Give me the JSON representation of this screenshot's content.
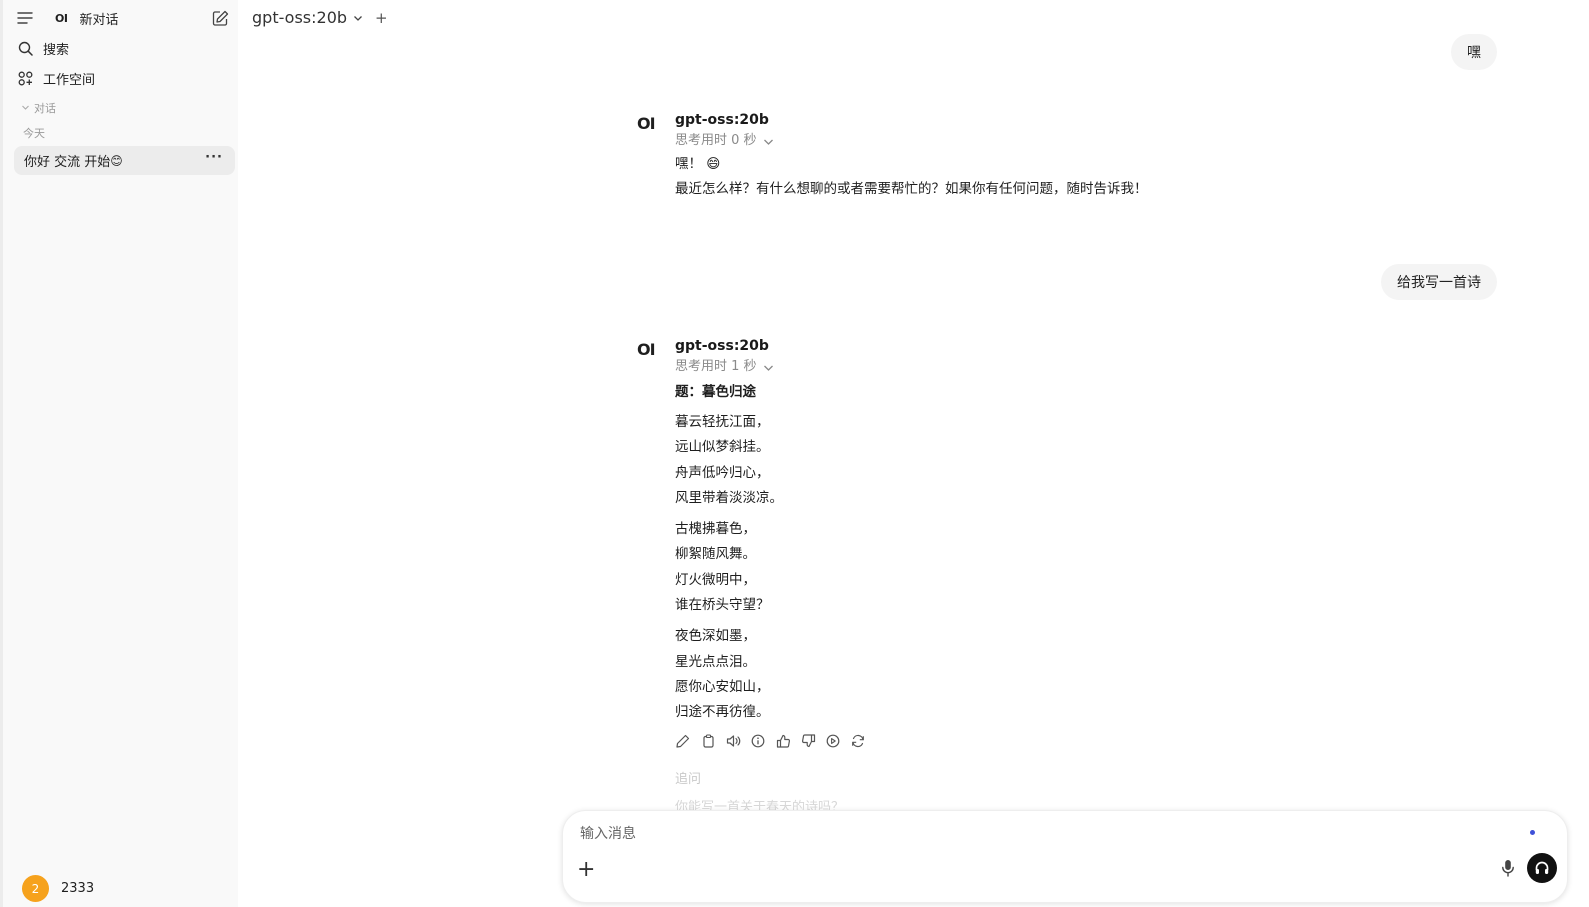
{
  "sidebar": {
    "logo": "OI",
    "new_chat": "新对话",
    "search": "搜索",
    "workspace": "工作空间",
    "section": "对话",
    "today": "今天",
    "chat_title": "你好 交流 开始",
    "chat_emoji": "😊",
    "more": "···",
    "user_initial": "2",
    "user_name": "2333"
  },
  "header": {
    "model": "gpt-oss:20b",
    "add": "+"
  },
  "conversation": {
    "user_msg_1": "嘿",
    "user_msg_2": "给我写一首诗",
    "assistant_avatar": "OI",
    "reply_1": {
      "model": "gpt-oss:20b",
      "thinking": "思考用时 0 秒",
      "line1": "嘿！",
      "line1_emoji": "😄",
      "line2": "最近怎么样？有什么想聊的或者需要帮忙的？如果你有任何问题，随时告诉我！"
    },
    "reply_2": {
      "model": "gpt-oss:20b",
      "thinking": "思考用时 1 秒",
      "title": "题：暮色归途",
      "stanzas": [
        [
          "暮云轻抚江面，",
          "远山似梦斜挂。",
          "舟声低吟归心，",
          "风里带着淡淡凉。"
        ],
        [
          "古槐拂暮色，",
          "柳絮随风舞。",
          "灯火微明中，",
          "谁在桥头守望？"
        ],
        [
          "夜色深如墨，",
          "星光点点泪。",
          "愿你心安如山，",
          "归途不再彷徨。"
        ]
      ]
    },
    "followup_label": "追问",
    "followup_item": "你能写一首关于春天的诗吗？"
  },
  "composer": {
    "placeholder": "输入消息",
    "plus": "+"
  },
  "icons": {
    "menu": "menu-icon",
    "edit": "edit-icon",
    "search": "search-icon",
    "workspace": "grid-icon",
    "edit_msg": "pencil-icon",
    "copy": "clipboard-icon",
    "speak": "speaker-icon",
    "info": "info-icon",
    "like": "thumbs-up-icon",
    "dislike": "thumbs-down-icon",
    "continue": "play-icon",
    "regenerate": "refresh-icon",
    "mic": "mic-icon",
    "voice": "headphones-icon"
  }
}
